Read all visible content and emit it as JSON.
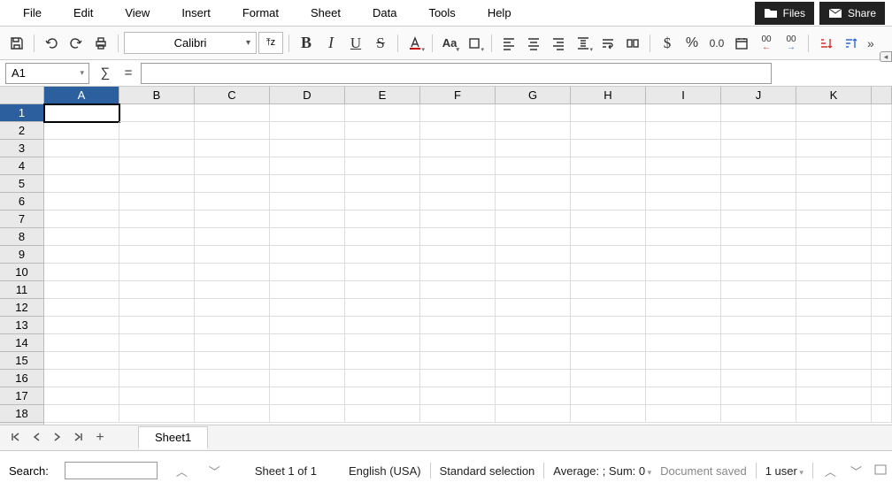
{
  "menubar": [
    "File",
    "Edit",
    "View",
    "Insert",
    "Format",
    "Sheet",
    "Data",
    "Tools",
    "Help"
  ],
  "topButtons": {
    "files": "Files",
    "share": "Share"
  },
  "toolbar": {
    "fontName": "Calibri",
    "fontSizeBox": "⤒z",
    "boldGlyph": "B",
    "italicGlyph": "I",
    "underlineGlyph": "U",
    "strikeGlyph": "S",
    "caseGlyph": "Aa",
    "currency": "$",
    "percent": "%",
    "numFmt": "0.0",
    "decGlyph1": "00",
    "decGlyph2": "00"
  },
  "formula": {
    "nameBox": "A1",
    "sigma": "∑",
    "equals": "=",
    "input": ""
  },
  "grid": {
    "columns": [
      "A",
      "B",
      "C",
      "D",
      "E",
      "F",
      "G",
      "H",
      "I",
      "J",
      "K"
    ],
    "rowCount": 18,
    "activeCol": "A",
    "activeRow": 1
  },
  "sheetTabs": {
    "first": "⏮",
    "prev": "‹",
    "next": "›",
    "last": "⏭",
    "add": "+",
    "tab": "Sheet1"
  },
  "status": {
    "searchLabel": "Search:",
    "searchValue": "",
    "sheetInfo": "Sheet 1 of 1",
    "language": "English (USA)",
    "selection": "Standard selection",
    "aggregate": "Average: ; Sum: 0",
    "saved": "Document saved",
    "users": "1 user",
    "more": "»"
  }
}
